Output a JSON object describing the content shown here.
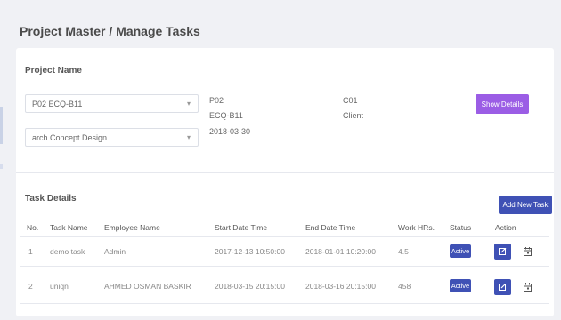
{
  "page": {
    "title": "Project Master / Manage Tasks"
  },
  "project": {
    "section_label": "Project Name",
    "project_select_value": "P02 ECQ-B11",
    "task_select_value": "arch Concept Design",
    "info_col1": [
      "P02",
      "ECQ-B11",
      "2018-03-30"
    ],
    "info_col2": [
      "C01",
      "Client"
    ],
    "show_details_label": "Show Details"
  },
  "tasks": {
    "section_label": "Task Details",
    "add_button_label": "Add New Task",
    "columns": [
      "No.",
      "Task Name",
      "Employee Name",
      "Start Date Time",
      "End Date Time",
      "Work HRs.",
      "Status",
      "Action"
    ],
    "rows": [
      {
        "no": "1",
        "task_name": "demo task",
        "employee": "Admin",
        "start": "2017-12-13 10:50:00",
        "end": "2018-01-01 10:20:00",
        "hours": "4.5",
        "status": "Active"
      },
      {
        "no": "2",
        "task_name": "uniqn",
        "employee": "AHMED OSMAN BASKIR",
        "start": "2018-03-15 20:15:00",
        "end": "2018-03-16 20:15:00",
        "hours": "458",
        "status": "Active"
      }
    ]
  },
  "colors": {
    "accent_blue": "#3f51b5",
    "accent_purple": "#9b5de5",
    "background": "#f0f1f5"
  },
  "icons": [
    "chevron-down-icon",
    "edit-icon",
    "calendar-icon"
  ]
}
